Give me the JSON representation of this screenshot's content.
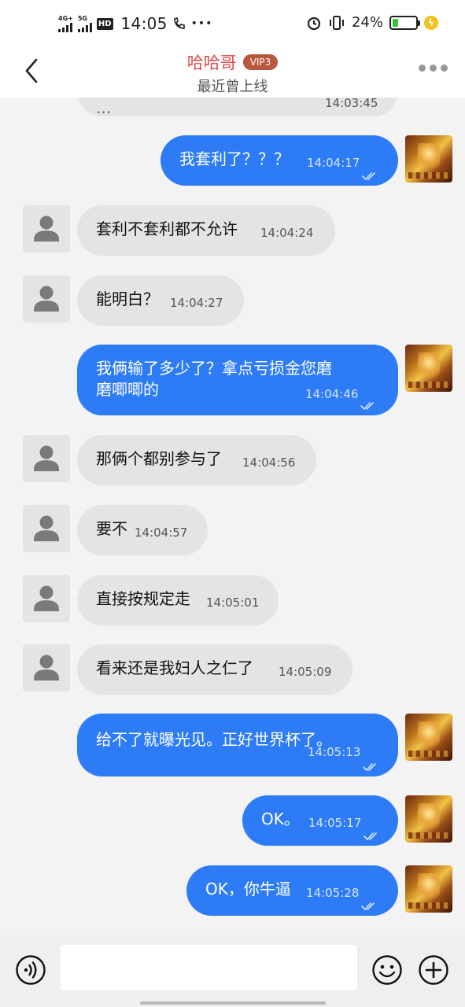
{
  "status_bar": {
    "net1": "4G+",
    "net2": "5G",
    "hd": "HD",
    "time": "14:05",
    "extra": "•••",
    "battery_text": "24%",
    "battery_level": 0.24,
    "colors": {
      "battery_fill": "#3cc23c",
      "charging": "#f4c21a"
    }
  },
  "header": {
    "contact_name": "哈哈哥",
    "vip_badge": "VIP3",
    "status": "最近曾上线",
    "colors": {
      "name": "#e04848",
      "vip_bg": "#b9583f"
    }
  },
  "messages": [
    {
      "from": "peer",
      "text": "...",
      "time": "14:03:45"
    },
    {
      "from": "me",
      "text": "我套利了？？？",
      "time": "14:04:17",
      "read": true
    },
    {
      "from": "peer",
      "text": "套利不套利都不允许",
      "time": "14:04:24"
    },
    {
      "from": "peer",
      "text": "能明白？",
      "time": "14:04:27"
    },
    {
      "from": "me",
      "lines": [
        "我俩输了多少了？拿点亏损金您磨",
        "磨唧唧的"
      ],
      "time": "14:04:46",
      "read": true
    },
    {
      "from": "peer",
      "text": "那俩个都别参与了",
      "time": "14:04:56"
    },
    {
      "from": "peer",
      "text": "要不",
      "time": "14:04:57"
    },
    {
      "from": "peer",
      "text": "直接按规定走",
      "time": "14:05:01"
    },
    {
      "from": "peer",
      "text": "看来还是我妇人之仁了",
      "time": "14:05:09"
    },
    {
      "from": "me",
      "text": "给不了就曝光见。正好世界杯了。",
      "time": "14:05:13",
      "read": true
    },
    {
      "from": "me",
      "text": "OK。",
      "time": "14:05:17",
      "read": true
    },
    {
      "from": "me",
      "text": "OK，你牛逼",
      "time": "14:05:28",
      "read": true
    }
  ],
  "input_bar": {
    "placeholder": "",
    "icons": [
      "voice-icon",
      "emoji-icon",
      "plus-icon"
    ]
  },
  "colors": {
    "outgoing_bubble": "#2d7cf6",
    "incoming_bubble": "#e4e4e4",
    "background": "#f3f3f3"
  }
}
